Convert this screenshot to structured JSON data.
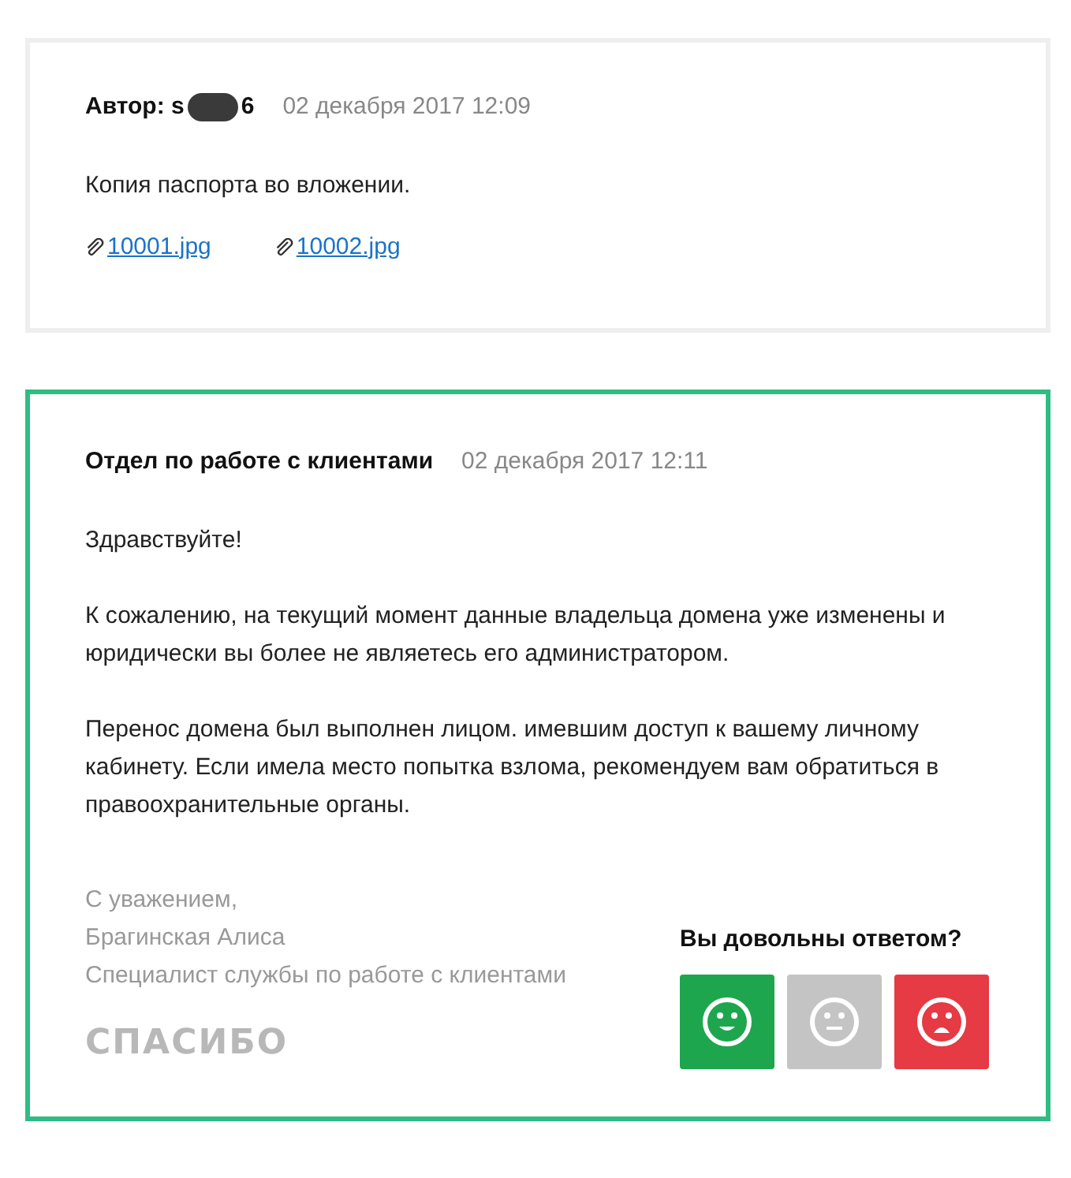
{
  "messages": [
    {
      "kind": "client",
      "author_label": "Автор:",
      "author_visible_start": "s",
      "author_visible_end": "6",
      "author_redacted": true,
      "date": "02 декабря 2017 12:09",
      "paragraphs": [
        "Копия паспорта во вложении."
      ],
      "attachments": [
        "10001.jpg",
        "10002.jpg"
      ]
    },
    {
      "kind": "support",
      "author": "Отдел по работе с клиентами",
      "date": "02 декабря 2017 12:11",
      "paragraphs": [
        "Здравствуйте!",
        "К сожалению, на текущий момент данные владельца домена уже изменены и юридически вы более не являетесь его администратором.",
        "Перенос домена был выполнен лицом. имевшим доступ к вашему личному кабинету. Если имела место попытка взлома, рекомендуем вам обратиться в правоохранительные органы."
      ],
      "signature": [
        "С уважением,",
        "Брагинская Алиса",
        "Специалист службы по работе с клиентами"
      ],
      "logo": "СПАСИБО",
      "rating": {
        "question": "Вы довольны ответом?",
        "options": [
          {
            "kind": "happy",
            "color": "#1ea64f"
          },
          {
            "kind": "neutral",
            "color": "#c4c4c4"
          },
          {
            "kind": "sad",
            "color": "#e63a44"
          }
        ]
      }
    }
  ]
}
